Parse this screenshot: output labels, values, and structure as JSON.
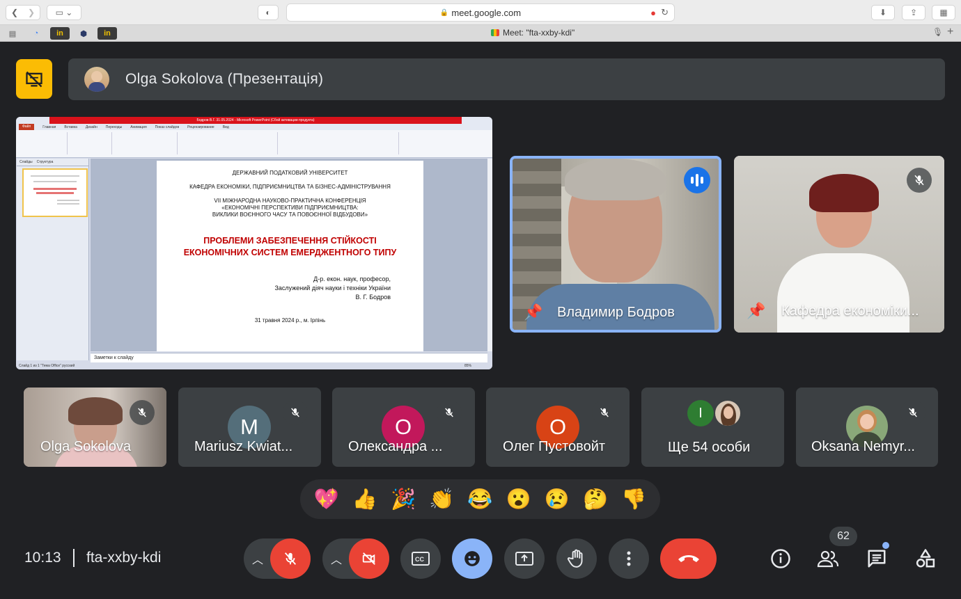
{
  "browser": {
    "url": "meet.google.com",
    "tab_title": "Meet: \"fta-xxby-kdi\"",
    "favorites": [
      "in",
      "in"
    ]
  },
  "presenter": {
    "banner_text": "Olga Sokolova (Презентація)"
  },
  "slide": {
    "window_title": "Бодров В.Г. 31.05.2024 - Microsoft PowerPoint (Сбой активации продукта)",
    "menu": [
      "Файл",
      "Главная",
      "Вставка",
      "Дизайн",
      "Переходы",
      "Анимация",
      "Показ слайдов",
      "Рецензирование",
      "Вид"
    ],
    "left_tabs": [
      "Слайды",
      "Структура"
    ],
    "line1": "ДЕРЖАВНИЙ ПОДАТКОВИЙ УНІВЕРСИТЕТ",
    "line2": "КАФЕДРА ЕКОНОМІКИ, ПІДПРИЄМНИЦТВА ТА БІЗНЕС-АДМІНІСТРУВАННЯ",
    "line3": "VII МІЖНАРОДНА НАУКОВО-ПРАКТИЧНА КОНФЕРЕНЦІЯ",
    "line4": "«ЕКОНОМІЧНІ ПЕРСПЕКТИВИ ПІДПРИЄМНИЦТВА:",
    "line5": "ВИКЛИКИ ВОЄННОГО ЧАСУ ТА ПОВОЄННОЇ ВІДБУДОВИ»",
    "title1": "ПРОБЛЕМИ ЗАБЕЗПЕЧЕННЯ СТІЙКОСТІ",
    "title2": "ЕКОНОМІЧНИХ СИСТЕМ ЕМЕРДЖЕНТНОГО ТИПУ",
    "author1": "Д-р. екон. наук, професор,",
    "author2": "Заслужений діяч науки і техніки України",
    "author3": "В. Г. Бодров",
    "date": "31 травня 2024 р., м. Ірпінь",
    "notes": "Заметки к слайду",
    "status": "Слайд 1 из 1   \"Тема Office\"   русский",
    "zoom": "85%"
  },
  "speakers": [
    {
      "name": "Владимир Бодров",
      "active": true
    },
    {
      "name": "Кафедра економіки..."
    }
  ],
  "participants": [
    {
      "name": "Olga Sokolova"
    },
    {
      "name": "Mariusz Kwiat...",
      "initial": "M",
      "color": "#546e7a"
    },
    {
      "name": "Олександра ...",
      "initial": "О",
      "color": "#c2185b"
    },
    {
      "name": "Олег Пустовойт",
      "initial": "О",
      "color": "#d84315"
    },
    {
      "name": "Ще 54 особи",
      "initial": "І",
      "color": "#2e7d32"
    },
    {
      "name": "Oksana Nemyr..."
    }
  ],
  "reactions": [
    "💖",
    "👍",
    "🎉",
    "👏",
    "😂",
    "😮",
    "😢",
    "🤔",
    "👎"
  ],
  "meeting": {
    "time": "10:13",
    "code": "fta-xxby-kdi",
    "participant_count": "62"
  },
  "colors": {
    "background": "#202124",
    "tile": "#3c4043",
    "end_call": "#ea4335",
    "active_blue": "#8ab4f8",
    "present_yellow": "#fbbc04"
  }
}
